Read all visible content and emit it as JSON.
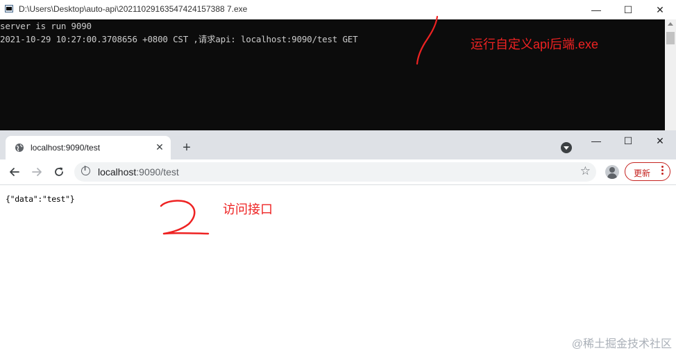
{
  "console_window": {
    "title": "D:\\Users\\Desktop\\auto-api\\20211029163547424157388 7.exe",
    "lines": [
      "server is run 9090",
      "2021-10-29 10:27:00.3708656 +0800 CST ,请求api: localhost:9090/test GET"
    ],
    "annotation": "运行自定义api后端.exe",
    "controls": {
      "minimize": "—",
      "maximize": "☐",
      "close": "✕"
    }
  },
  "browser": {
    "tab_title": "localhost:9090/test",
    "tab_close": "✕",
    "new_tab": "+",
    "url_host": "localhost",
    "url_rest": ":9090/test",
    "update_label": "更新",
    "controls": {
      "minimize": "—",
      "maximize": "☐",
      "close": "✕"
    },
    "page_text": "{\"data\":\"test\"}",
    "annotation": "访问接口"
  },
  "watermark": "@稀土掘金技术社区",
  "colors": {
    "annotation": "#ee2222",
    "console_bg": "#0c0c0c",
    "update_accent": "#c5221f"
  },
  "icons": [
    "app-icon",
    "minimize-icon",
    "maximize-icon",
    "close-icon",
    "globe-icon",
    "back-arrow-icon",
    "forward-arrow-icon",
    "reload-icon",
    "info-icon",
    "star-icon",
    "profile-icon",
    "more-vert-icon",
    "tab-search-icon"
  ]
}
